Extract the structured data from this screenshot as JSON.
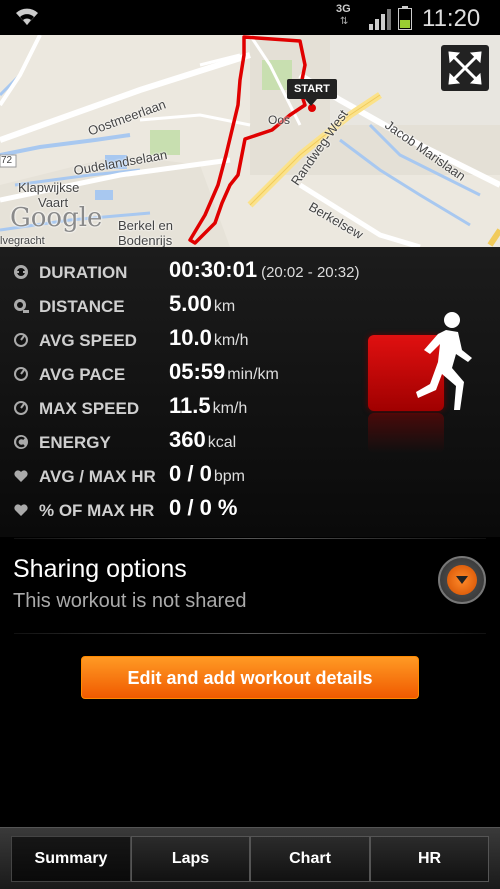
{
  "status_bar": {
    "network": "3G",
    "network_arrows": "⇅",
    "time": "11:20"
  },
  "map": {
    "labels": {
      "street_1": "Oostmeerlaan",
      "street_2": "Oudelandselaan",
      "street_3": "Randweg-West",
      "street_4": "Jacob Marislaan",
      "street_5": "Berkelsew",
      "place_1": "Klapwijkse",
      "place_2": "Vaart",
      "place_3": "Berkel en",
      "place_4": "Bodenrijs",
      "place_5": "lvegracht",
      "road_num": "72",
      "fragment": "Oos"
    },
    "google_logo": "Google",
    "start_marker": "START",
    "colors": {
      "route": "#e00000",
      "land": "#ece8df",
      "water": "#a8c8f0"
    }
  },
  "stats": {
    "duration": {
      "label": "DURATION",
      "value": "00:30:01",
      "extra": "(20:02 - 20:32)"
    },
    "distance": {
      "label": "DISTANCE",
      "value": "5.00",
      "unit": "km"
    },
    "avg_speed": {
      "label": "AVG SPEED",
      "value": "10.0",
      "unit": "km/h"
    },
    "avg_pace": {
      "label": "AVG PACE",
      "value": "05:59",
      "unit": "min/km"
    },
    "max_speed": {
      "label": "MAX SPEED",
      "value": "11.5",
      "unit": "km/h"
    },
    "energy": {
      "label": "ENERGY",
      "value": "360",
      "unit": "kcal"
    },
    "avg_max_hr": {
      "label": "AVG / MAX HR",
      "value": "0 / 0",
      "unit": "bpm"
    },
    "pct_max_hr": {
      "label": "% OF MAX HR",
      "value": "0 / 0 %",
      "unit": ""
    }
  },
  "sharing": {
    "title": "Sharing options",
    "subtitle": "This workout is not shared"
  },
  "edit_button": "Edit and add workout details",
  "tabs": [
    {
      "label": "Summary",
      "active": true
    },
    {
      "label": "Laps",
      "active": false
    },
    {
      "label": "Chart",
      "active": false
    },
    {
      "label": "HR",
      "active": false
    }
  ],
  "accent_color": "#ff7a00"
}
